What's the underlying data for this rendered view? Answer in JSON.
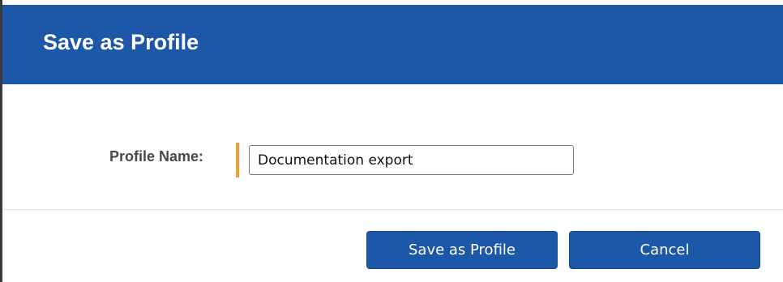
{
  "dialog": {
    "title": "Save as Profile"
  },
  "form": {
    "profile_name_label": "Profile Name:",
    "profile_name_value": "Documentation export",
    "required_marker_color": "#f0a030"
  },
  "buttons": {
    "save_label": "Save as Profile",
    "cancel_label": "Cancel"
  },
  "colors": {
    "header_bg": "#1c57a8",
    "button_bg": "#1c57a8"
  }
}
